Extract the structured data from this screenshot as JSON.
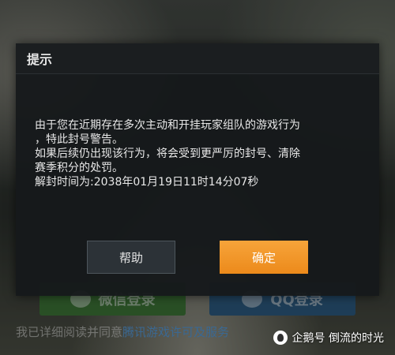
{
  "dialog": {
    "title": "提示",
    "message_lines": [
      "由于您在近期存在多次主动和开挂玩家组队的游戏行为",
      "，特此封号警告。",
      "如果后续仍出现该行为，将会受到更严厉的封号、清除",
      "赛季积分的处罚。",
      "解封时间为:2038年01月19日11时14分07秒"
    ],
    "help_label": "帮助",
    "confirm_label": "确定"
  },
  "background": {
    "wechat_login_label": "微信登录",
    "qq_login_label": "QQ登录",
    "agreement_prefix": "我已详细阅读并同意",
    "agreement_link": "腾讯游戏许可及服务"
  },
  "watermark": {
    "text": "企鹅号 倒流的时光"
  },
  "colors": {
    "confirm_button": "#f29a2e",
    "dialog_bg": "#16191b",
    "wechat_green": "#3f7a3a",
    "qq_blue": "#2f5f86"
  }
}
